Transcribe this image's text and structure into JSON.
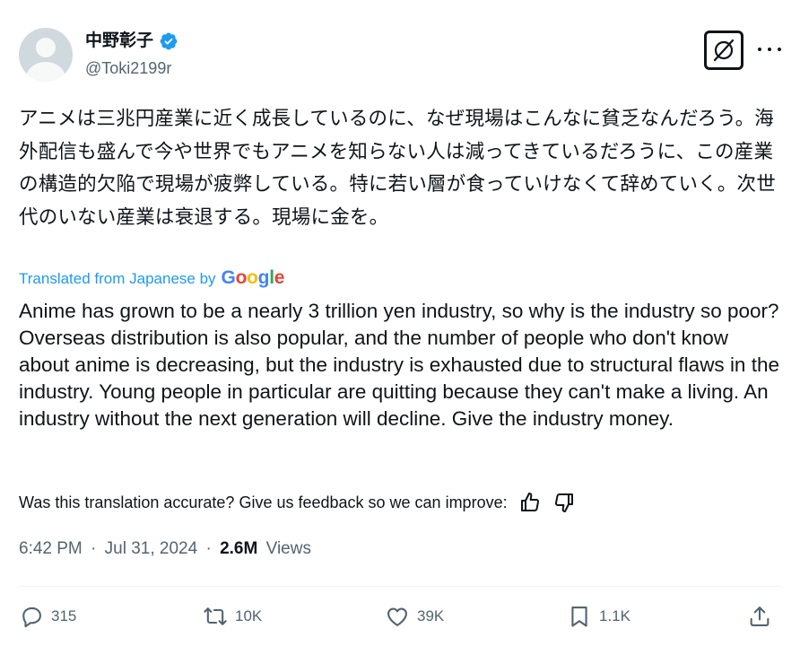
{
  "author": {
    "display_name": "中野彰子",
    "handle": "@Toki2199r",
    "avatar_icon": "default-avatar-icon",
    "verified_icon": "verified-badge-icon"
  },
  "header_actions": {
    "grok_icon": "grok-icon",
    "more_icon": "more-options-icon"
  },
  "post": {
    "original_text": "アニメは三兆円産業に近く成長しているのに、なぜ現場はこんなに貧乏なんだろう。海外配信も盛んで今や世界でもアニメを知らない人は減ってきているだろうに、この産業の構造的欠陥で現場が疲弊している。特に若い層が食っていけなくて辞めていく。次世代のいない産業は衰退する。現場に金を。",
    "translated_label": "Translated from Japanese by",
    "translation_provider": "Google",
    "translated_text": "Anime has grown to be a nearly 3 trillion yen industry, so why is the industry so poor? Overseas distribution is also popular, and the number of people who don't know about anime is decreasing, but the industry is exhausted due to structural flaws in the industry. Young people in particular are quitting because they can't make a living. An industry without the next generation will decline. Give the industry money.",
    "feedback_prompt": "Was this translation accurate? Give us feedback so we can improve:",
    "feedback_icons": [
      "thumbs-up-icon",
      "thumbs-down-icon"
    ]
  },
  "meta": {
    "time": "6:42 PM",
    "separator": "·",
    "date": "Jul 31, 2024",
    "views_count": "2.6M",
    "views_label": "Views"
  },
  "actions": {
    "replies": "315",
    "reposts": "10K",
    "likes": "39K",
    "bookmarks": "1.1K"
  },
  "colors": {
    "link_blue": "#1d9bf0",
    "secondary_text": "#536471",
    "primary_text": "#0f1419"
  }
}
